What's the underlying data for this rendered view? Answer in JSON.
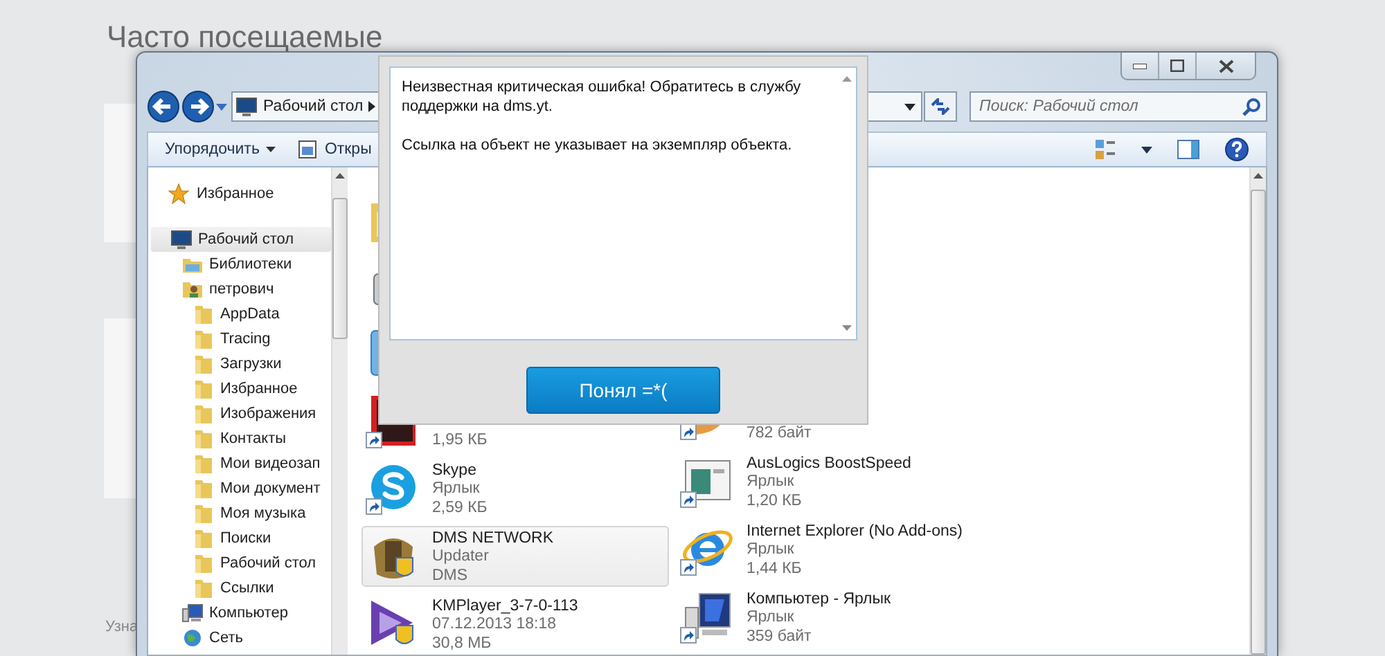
{
  "background_page": {
    "heading": "Часто посещаемые",
    "footer_text": "Узна"
  },
  "explorer": {
    "address": "Рабочий стол",
    "search": {
      "placeholder": "Поиск: Рабочий стол"
    },
    "toolbar": [
      {
        "label": "Упорядочить",
        "kind": "menu"
      },
      {
        "label": "Откры",
        "kind": "open"
      }
    ],
    "favorites": {
      "label": "Избранное",
      "selected": false
    },
    "nav": [
      {
        "label": "Рабочий стол",
        "selected": true,
        "children": [
          {
            "label": "Библиотеки",
            "selected": false
          },
          {
            "label": "петрович",
            "selected": false,
            "children": [
              {
                "label": "AppData",
                "selected": false
              },
              {
                "label": "Tracing",
                "selected": false
              },
              {
                "label": "Загрузки",
                "selected": false
              },
              {
                "label": "Избранное",
                "selected": false
              },
              {
                "label": "Изображения",
                "selected": false
              },
              {
                "label": "Контакты",
                "selected": false
              },
              {
                "label": "Мои видеозап",
                "selected": false
              },
              {
                "label": "Мои документ",
                "selected": false
              },
              {
                "label": "Моя музыка",
                "selected": false
              },
              {
                "label": "Поиски",
                "selected": false
              },
              {
                "label": "Рабочий стол",
                "selected": false
              },
              {
                "label": "Ссылки",
                "selected": false
              }
            ]
          },
          {
            "label": "Компьютер",
            "selected": false
          },
          {
            "label": "Сеть",
            "selected": false
          }
        ]
      }
    ],
    "left_column": [
      {
        "shortcut": false,
        "selected": false
      },
      {
        "shortcut": false,
        "selected": false
      },
      {
        "shortcut": false,
        "selected": false
      },
      {
        "shortcut": true,
        "selected": false,
        "lines": [
          "1,95 КБ"
        ]
      },
      {
        "shortcut": true,
        "selected": false,
        "lines": [
          "Skype",
          "Ярлык",
          "2,59 КБ"
        ]
      },
      {
        "shortcut": false,
        "selected": true,
        "lines": [
          "DMS NETWORK",
          "Updater",
          "DMS"
        ]
      },
      {
        "shortcut": false,
        "selected": false,
        "lines": [
          "KMPlayer_3-7-0-113",
          "07.12.2013 18:18",
          "30,8 МБ"
        ]
      }
    ],
    "right_column": [
      {
        "shortcut": true,
        "selected": false,
        "lines": [
          "782 байт"
        ]
      },
      {
        "shortcut": true,
        "selected": false,
        "lines": [
          "AusLogics BoostSpeed",
          "Ярлык",
          "1,20 КБ"
        ]
      },
      {
        "shortcut": true,
        "selected": false,
        "lines": [
          "Internet Explorer (No Add-ons)",
          "Ярлык",
          "1,44 КБ"
        ]
      },
      {
        "shortcut": true,
        "selected": false,
        "lines": [
          "Компьютер - Ярлык",
          "Ярлык",
          "359 байт"
        ]
      }
    ]
  },
  "dialog": {
    "message": [
      "Неизвестная критическая ошибка! Обратитесь в службу поддержки на dms.yt.",
      "Ссылка на объект не указывает на экземпляр объекта."
    ],
    "button": "Понял =*("
  }
}
